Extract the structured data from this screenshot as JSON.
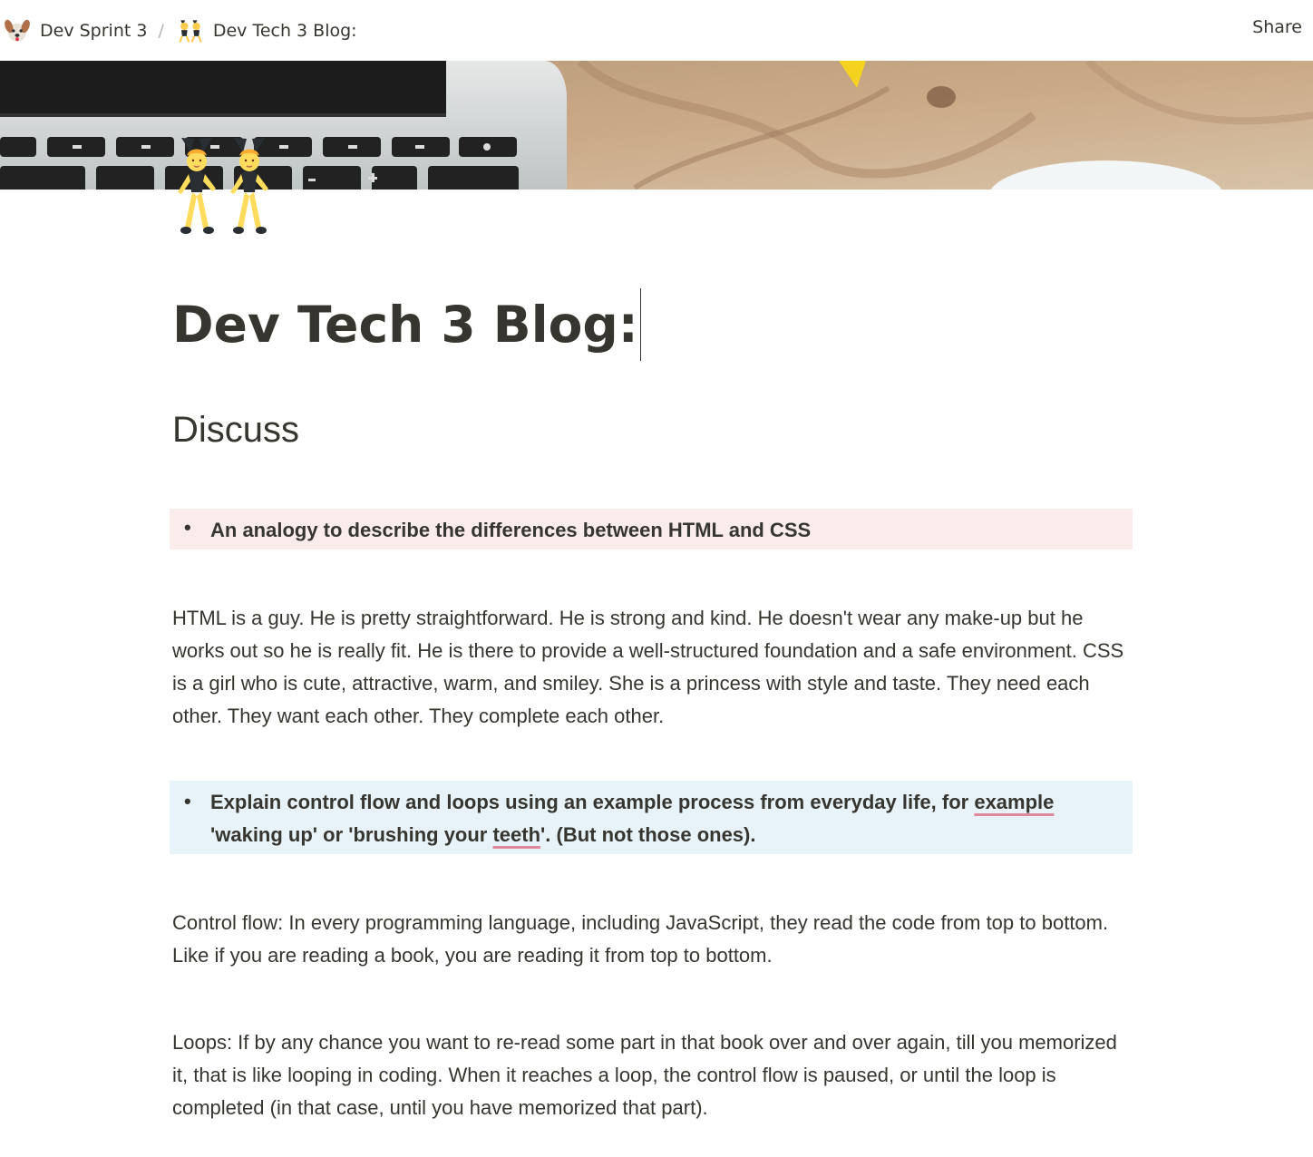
{
  "topbar": {
    "breadcrumbs": [
      {
        "icon": "dog-face-icon",
        "label": "Dev Sprint 3"
      },
      {
        "icon": "women-with-bunny-ears-icon",
        "label": "Dev Tech 3 Blog:"
      }
    ],
    "separator": "/",
    "share_label": "Share"
  },
  "page": {
    "icon": "women-with-bunny-ears-icon",
    "title": "Dev Tech 3 Blog:",
    "heading": "Discuss",
    "callout_1": {
      "text": "An analogy to describe the differences between HTML and CSS",
      "color": "#fbecec"
    },
    "paragraph_1": "HTML is a guy. He is pretty straightforward. He is strong and kind. He doesn't wear any make-up but he works out so he is really fit. He is there to provide a well-structured foundation and a safe environment. CSS is a girl who is cute, attractive, warm, and smiley. She is a princess with style and taste. They need each other. They want each other. They complete each other.",
    "callout_2": {
      "text_before": "Explain control flow and loops using an example process from everyday life, for ",
      "underlined_1": "example",
      "text_middle": " 'waking up' or 'brushing your ",
      "underlined_2": "teeth",
      "text_after": "'. (But not those ones).",
      "color": "#e7f3f8"
    },
    "paragraph_2": "Control flow: In every programming language, including JavaScript, they read the code from top to bottom.  Like if you are reading a book, you are reading it from top to bottom.",
    "paragraph_3": "Loops: If by any chance you want to re-read some part in that book over and over again, till you memorized it, that is like looping in coding. When it reaches a loop, the control flow is paused, or until the loop is completed (in that case, until you have memorized that part)."
  }
}
